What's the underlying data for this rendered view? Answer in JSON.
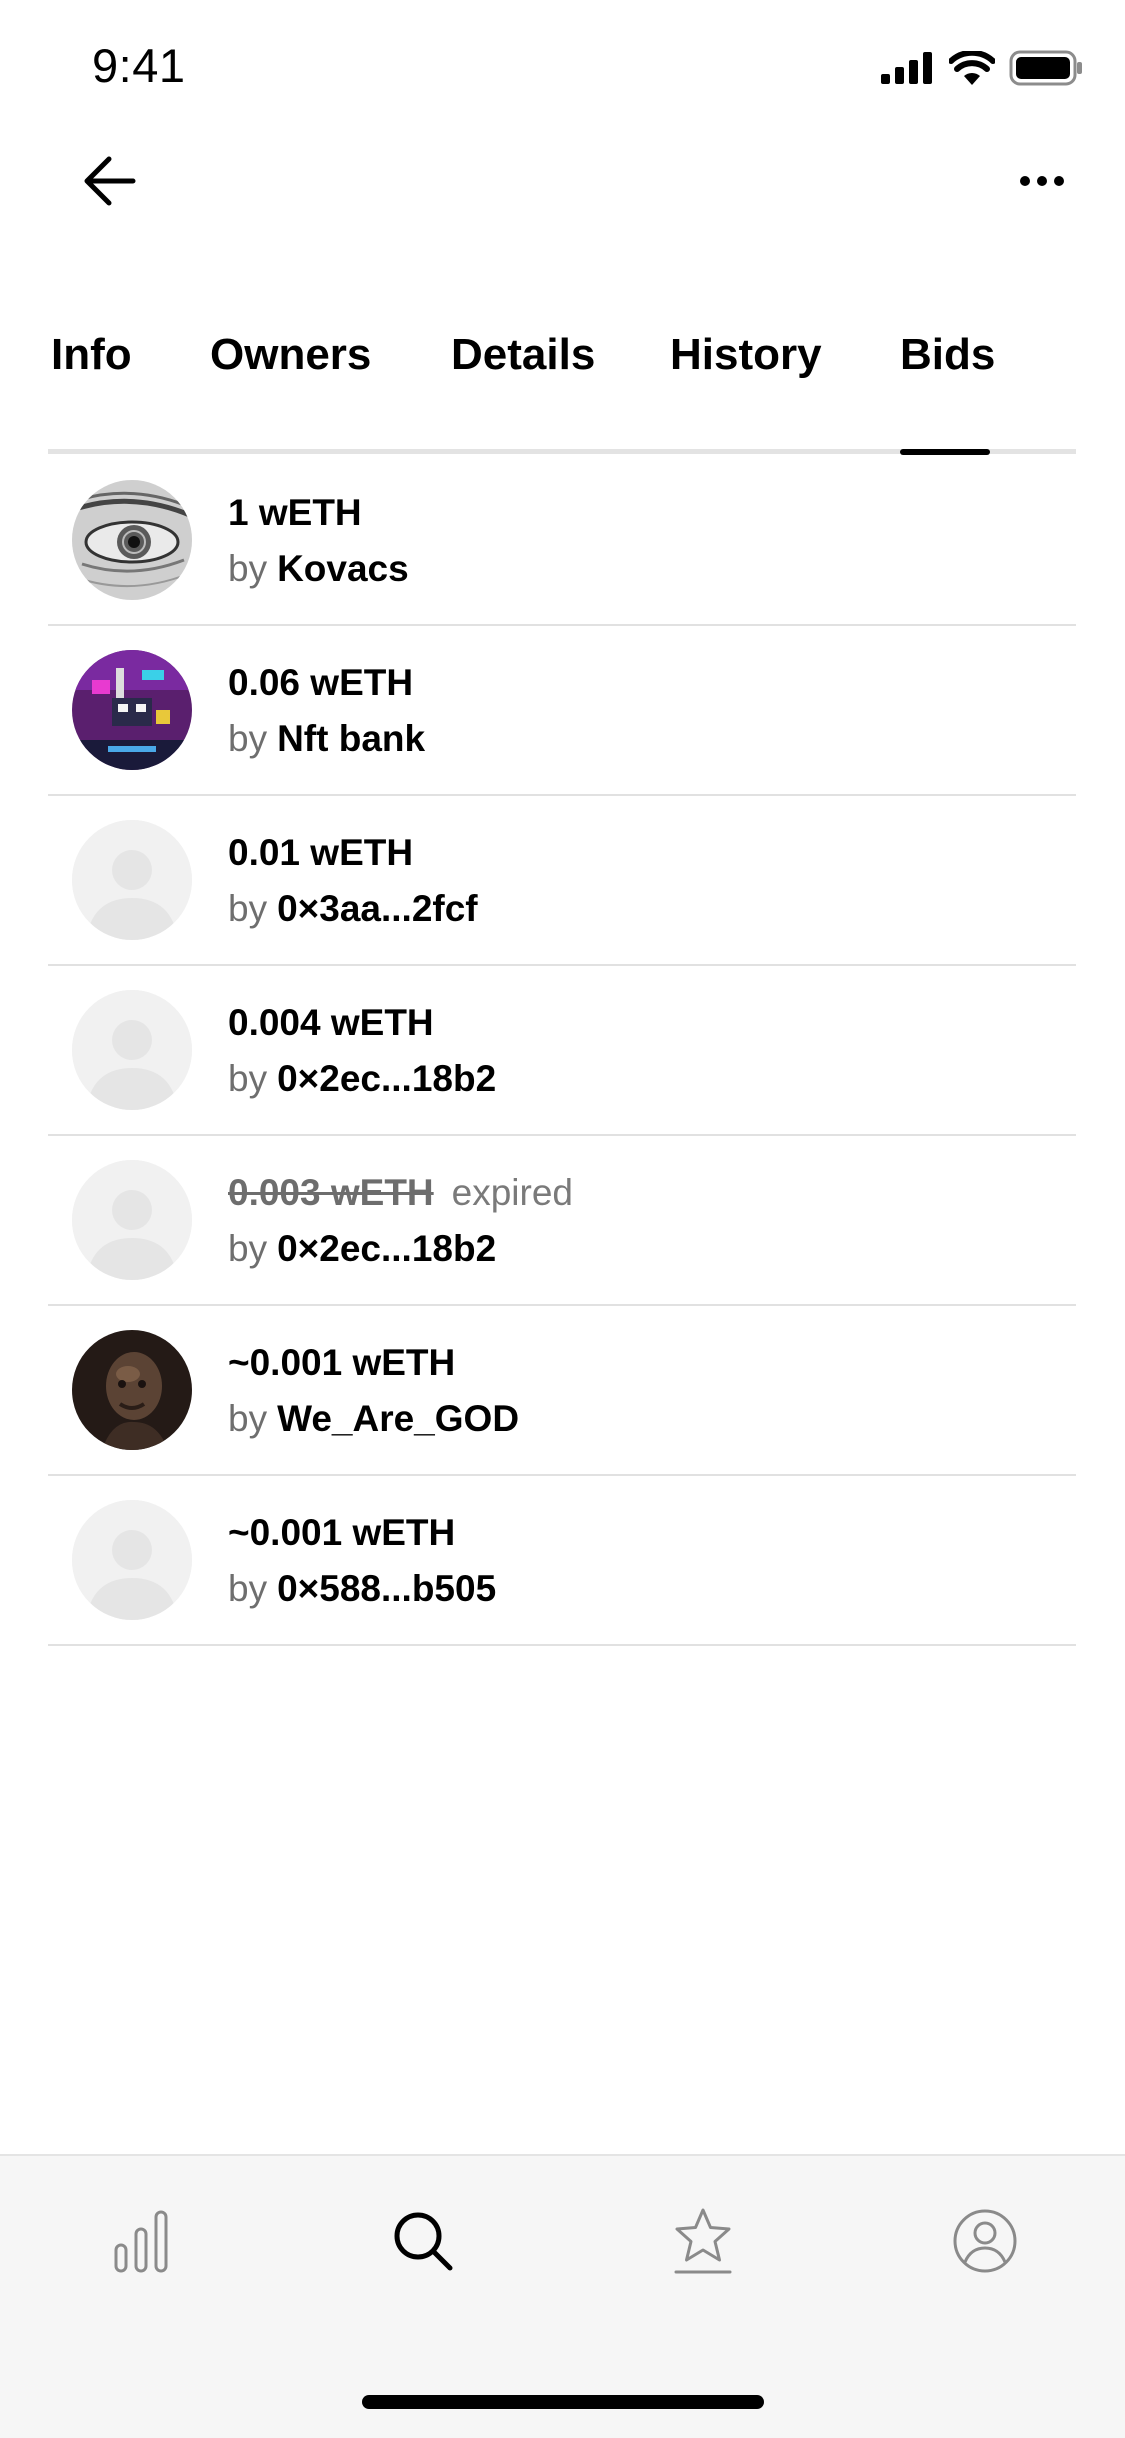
{
  "status_bar": {
    "time": "9:41"
  },
  "tabs": [
    {
      "label": "Info",
      "active": false
    },
    {
      "label": "Owners",
      "active": false
    },
    {
      "label": "Details",
      "active": false
    },
    {
      "label": "History",
      "active": false
    },
    {
      "label": "Bids",
      "active": true
    }
  ],
  "bids": [
    {
      "amount": "1 wETH",
      "by_label": "by",
      "bidder": "Kovacs",
      "expired": false,
      "expired_label": "",
      "avatar": "eye-artwork-avatar"
    },
    {
      "amount": "0.06 wETH",
      "by_label": "by",
      "bidder": "Nft bank",
      "expired": false,
      "expired_label": "",
      "avatar": "pixel-art-avatar"
    },
    {
      "amount": "0.01 wETH",
      "by_label": "by",
      "bidder": "0×3aa...2fcf",
      "expired": false,
      "expired_label": "",
      "avatar": "default-user-avatar"
    },
    {
      "amount": "0.004 wETH",
      "by_label": "by",
      "bidder": "0×2ec...18b2",
      "expired": false,
      "expired_label": "",
      "avatar": "default-user-avatar"
    },
    {
      "amount": "0.003 wETH",
      "by_label": "by",
      "bidder": "0×2ec...18b2",
      "expired": true,
      "expired_label": "expired",
      "avatar": "default-user-avatar"
    },
    {
      "amount": "~0.001 wETH",
      "by_label": "by",
      "bidder": "We_Are_GOD",
      "expired": false,
      "expired_label": "",
      "avatar": "dark-portrait-avatar"
    },
    {
      "amount": "~0.001 wETH",
      "by_label": "by",
      "bidder": "0×588...b505",
      "expired": false,
      "expired_label": "",
      "avatar": "default-user-avatar"
    }
  ],
  "bottom_nav": [
    {
      "icon": "bar-chart-icon",
      "active": false
    },
    {
      "icon": "search-icon",
      "active": true
    },
    {
      "icon": "star-icon",
      "active": false
    },
    {
      "icon": "profile-icon",
      "active": false
    }
  ],
  "colors": {
    "active_tab_indicator": "#000000",
    "muted_text": "#6e6e6e",
    "divider": "#e1e1e1",
    "tab_bar_bg": "#f6f6f6"
  }
}
